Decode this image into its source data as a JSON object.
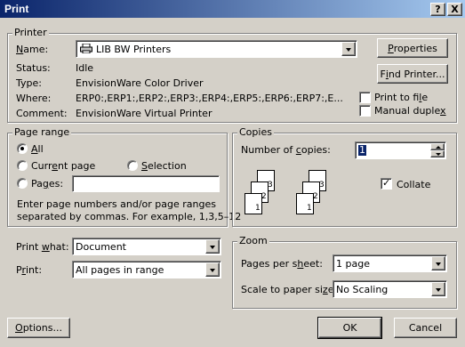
{
  "window": {
    "title": "Print",
    "help_label": "?",
    "close_label": "X"
  },
  "printer": {
    "group_label": "Printer",
    "name_label": "Name:",
    "name_value": "LIB BW Printers",
    "properties_label": "Properties",
    "find_printer_label": "Find Printer...",
    "status_label": "Status:",
    "status_value": "Idle",
    "type_label": "Type:",
    "type_value": "EnvisionWare Color Driver",
    "where_label": "Where:",
    "where_value": "ERP0:,ERP1:,ERP2:,ERP3:,ERP4:,ERP5:,ERP6:,ERP7:,E...",
    "comment_label": "Comment:",
    "comment_value": "EnvisionWare Virtual Printer",
    "print_to_file_label": "Print to file",
    "print_to_file_checked": false,
    "manual_duplex_label": "Manual duplex",
    "manual_duplex_checked": false
  },
  "page_range": {
    "group_label": "Page range",
    "all_label": "All",
    "current_page_label": "Current page",
    "selection_label": "Selection",
    "pages_label": "Pages:",
    "pages_value": "",
    "selected": "All",
    "hint_line1": "Enter page numbers and/or page ranges",
    "hint_line2": "separated by commas.  For example, 1,3,5–12"
  },
  "copies": {
    "group_label": "Copies",
    "number_label": "Number of copies:",
    "number_value": "1",
    "collate_label": "Collate",
    "collate_checked": true,
    "page_numbers": [
      "1",
      "2",
      "3",
      "1",
      "2",
      "3"
    ]
  },
  "print_what": {
    "label": "Print what:",
    "value": "Document"
  },
  "print": {
    "label": "Print:",
    "value": "All pages in range"
  },
  "zoom": {
    "group_label": "Zoom",
    "pages_per_sheet_label": "Pages per sheet:",
    "pages_per_sheet_value": "1 page",
    "scale_label": "Scale to paper size:",
    "scale_value": "No Scaling"
  },
  "footer": {
    "options_label": "Options...",
    "ok_label": "OK",
    "cancel_label": "Cancel"
  }
}
